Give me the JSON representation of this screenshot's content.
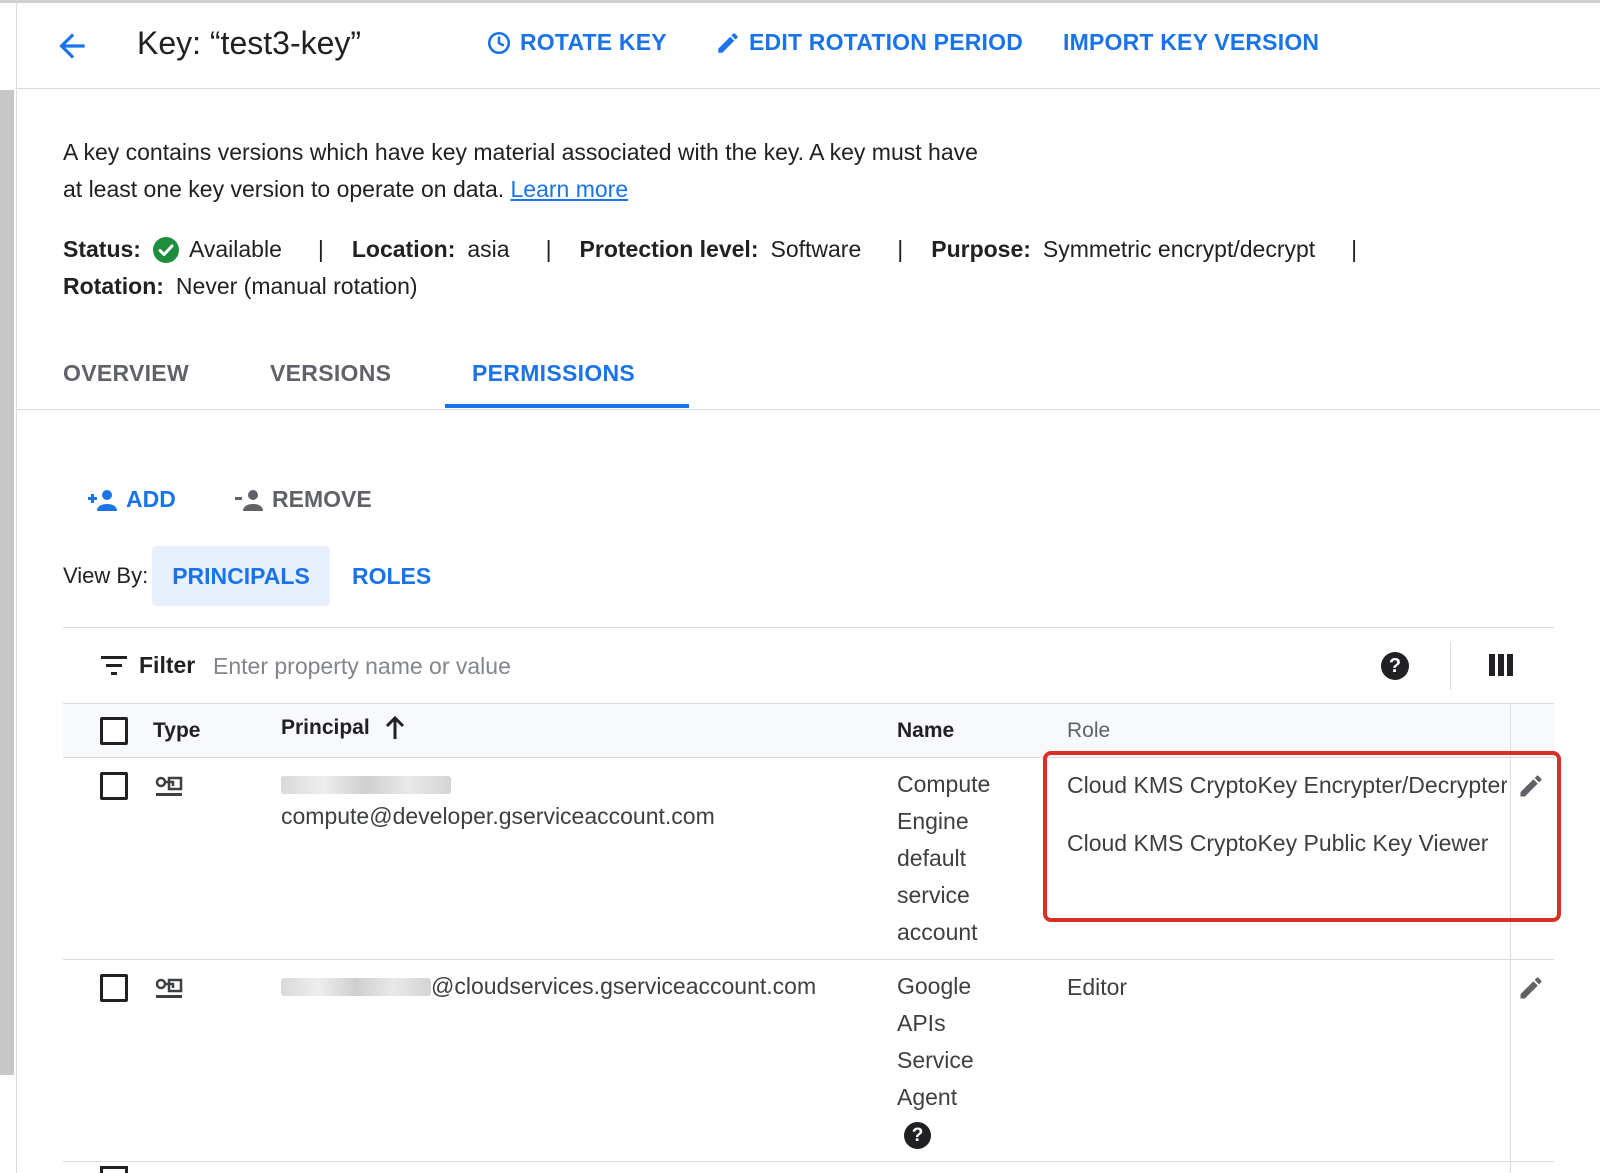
{
  "header": {
    "title": "Key: “test3-key”",
    "actions": {
      "rotate": "ROTATE KEY",
      "edit_rotation": "EDIT ROTATION PERIOD",
      "import_version": "IMPORT KEY VERSION"
    }
  },
  "description": {
    "text": "A key contains versions which have key material associated with the key. A key must have at least one key version to operate on data.",
    "learn_more": "Learn more"
  },
  "meta": {
    "status_label": "Status:",
    "status_value": "Available",
    "location_label": "Location:",
    "location_value": "asia",
    "protection_label": "Protection level:",
    "protection_value": "Software",
    "purpose_label": "Purpose:",
    "purpose_value": "Symmetric encrypt/decrypt",
    "rotation_label": "Rotation:",
    "rotation_value": "Never (manual rotation)",
    "separator": "|"
  },
  "tabs": {
    "overview": "OVERVIEW",
    "versions": "VERSIONS",
    "permissions": "PERMISSIONS",
    "active": "PERMISSIONS"
  },
  "toolbar": {
    "add": "ADD",
    "remove": "REMOVE"
  },
  "view_by": {
    "label": "View By:",
    "principals": "PRINCIPALS",
    "roles": "ROLES",
    "selected": "PRINCIPALS"
  },
  "filter": {
    "label": "Filter",
    "placeholder": "Enter property name or value"
  },
  "table": {
    "headers": {
      "type": "Type",
      "principal": "Principal",
      "name": "Name",
      "role": "Role"
    },
    "rows": [
      {
        "principal": "compute@developer.gserviceaccount.com",
        "name": [
          "Compute",
          "Engine",
          "default",
          "service",
          "account"
        ],
        "roles": [
          "Cloud KMS CryptoKey Encrypter/Decrypter",
          "Cloud KMS CryptoKey Public Key Viewer"
        ]
      },
      {
        "principal": "@cloudservices.gserviceaccount.com",
        "name": [
          "Google",
          "APIs",
          "Service",
          "Agent"
        ],
        "roles": [
          "Editor"
        ]
      }
    ]
  },
  "colors": {
    "accent": "#1a73e8",
    "highlight": "#d93025",
    "status_ok": "#1e8e3e"
  }
}
